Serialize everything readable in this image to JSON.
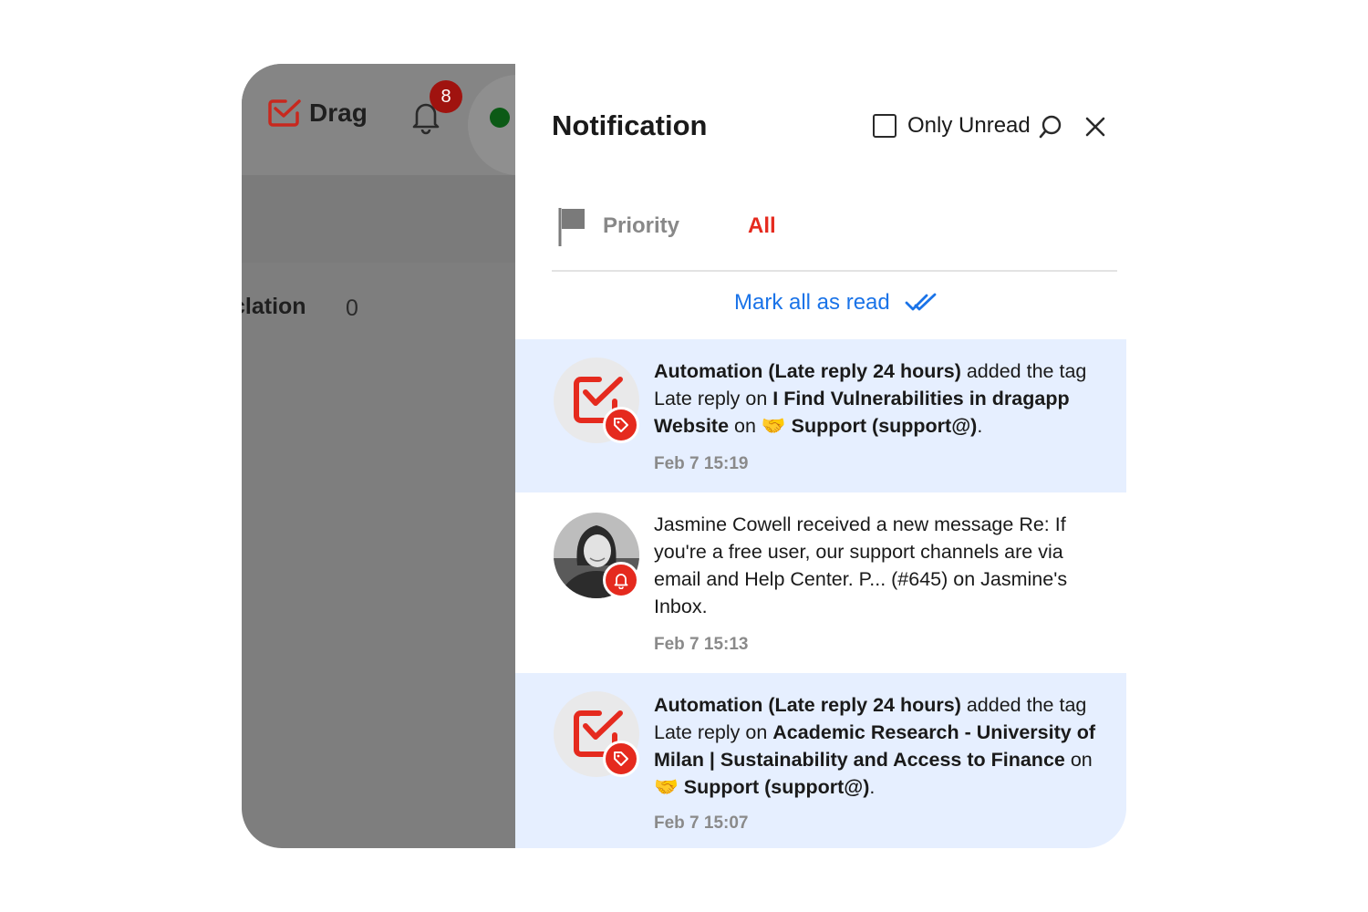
{
  "backdrop": {
    "app_name": "Drag",
    "notification_count": "8",
    "escalation_label": "clation",
    "escalation_count": "0"
  },
  "panel": {
    "title": "Notification",
    "only_unread_label": "Only Unread",
    "only_unread_checked": false
  },
  "filters": {
    "priority_label": "Priority",
    "all_label": "All",
    "active": "All"
  },
  "mark_all_label": "Mark all as read",
  "colors": {
    "accent_red": "#e52a1e",
    "link_blue": "#1a73e8",
    "unread_bg": "#e6efff",
    "badge_dark_red": "#a0130f",
    "status_green": "#0c5a16"
  },
  "notifications": [
    {
      "unread": true,
      "icon": "drag-logo-icon",
      "sub_icon": "tag-icon",
      "segments": [
        {
          "text": "Automation (Late reply 24 hours)",
          "bold": true
        },
        {
          "text": " added the tag Late reply on ",
          "bold": false
        },
        {
          "text": "I Find Vulnerabilities in dragapp Website",
          "bold": true
        },
        {
          "text": " on ",
          "bold": false
        },
        {
          "text": "🤝 Support (support@)",
          "bold": true
        },
        {
          "text": ".",
          "bold": false
        }
      ],
      "time": "Feb 7 15:19"
    },
    {
      "unread": false,
      "icon": "user-avatar",
      "sub_icon": "bell-icon",
      "segments": [
        {
          "text": "Jasmine Cowell received a new message Re: If you're a free user, our support channels are via email and Help Center. P... (#645) on Jasmine's Inbox.",
          "bold": false
        }
      ],
      "time": "Feb 7 15:13"
    },
    {
      "unread": true,
      "icon": "drag-logo-icon",
      "sub_icon": "tag-icon",
      "segments": [
        {
          "text": "Automation (Late reply 24 hours)",
          "bold": true
        },
        {
          "text": " added the tag Late reply on ",
          "bold": false
        },
        {
          "text": "Academic Research - University of Milan | Sustainability and Access to Finance",
          "bold": true
        },
        {
          "text": " on ",
          "bold": false
        },
        {
          "text": "🤝 Support (support@)",
          "bold": true
        },
        {
          "text": ".",
          "bold": false
        }
      ],
      "time": "Feb 7 15:07"
    }
  ]
}
